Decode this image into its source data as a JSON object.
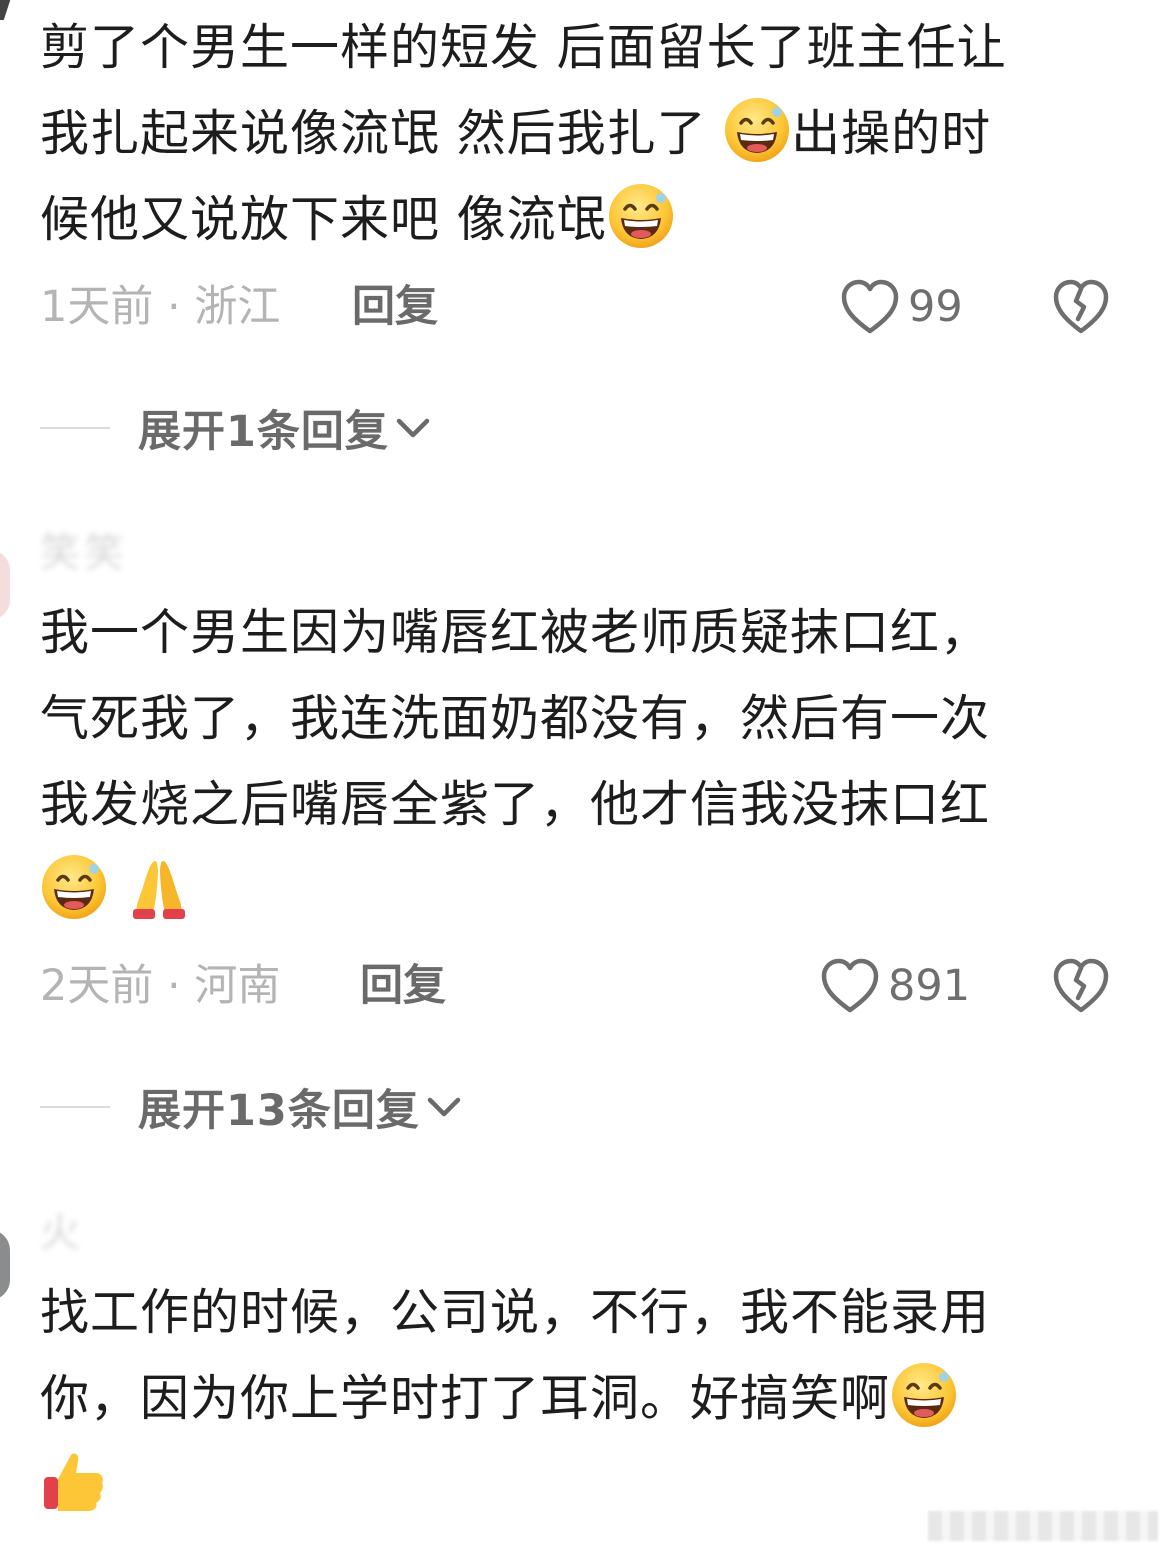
{
  "comments": [
    {
      "username": "",
      "text_lines": [
        "剪了个男生一样的短发 后面留长了班主任让",
        "我扎起来说像流氓 然后我扎了 ",
        "出操的时",
        "候他又说放下来吧 像流氓"
      ],
      "time_location": "1天前 · 浙江",
      "reply_label": "回复",
      "likes": "99",
      "expand_label": "展开1条回复"
    },
    {
      "username": "笑笑",
      "text_lines": [
        "我一个男生因为嘴唇红被老师质疑抹口红，",
        "气死我了，我连洗面奶都没有，然后有一次",
        "我发烧之后嘴唇全紫了，他才信我没抹口红"
      ],
      "time_location": "2天前 · 河南",
      "reply_label": "回复",
      "likes": "891",
      "expand_label": "展开13条回复"
    },
    {
      "username": "火",
      "text_lines": [
        "找工作的时候，公司说，不行，我不能录用",
        "你，因为你上学时打了耳洞。好搞笑啊"
      ]
    }
  ],
  "icons": {
    "grin": "grinning-face-emoji",
    "pray": "folded-hands-emoji",
    "thumbs": "thumbs-up-emoji",
    "like": "heart-outline-icon",
    "dislike": "broken-heart-icon",
    "chevron": "chevron-down-icon"
  },
  "colors": {
    "text": "#1d1d1d",
    "meta": "#b4b4b4",
    "action": "#6a6a6a"
  }
}
